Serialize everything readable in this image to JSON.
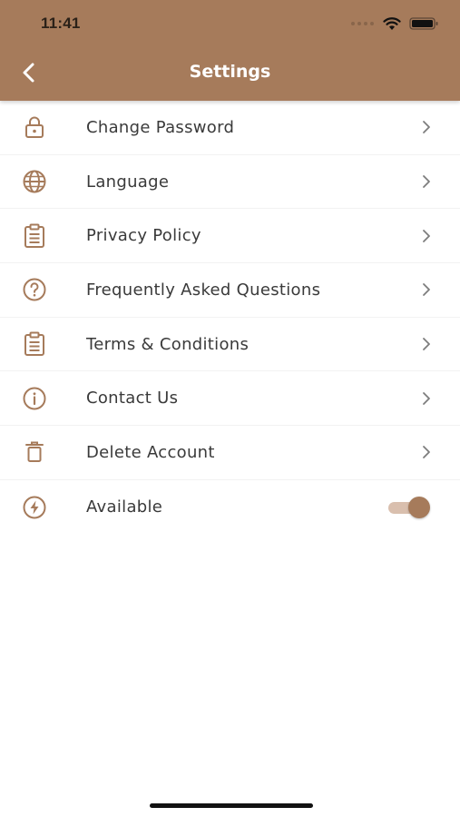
{
  "status_bar": {
    "time": "11:41"
  },
  "header": {
    "title": "Settings"
  },
  "colors": {
    "accent": "#a67b5b",
    "toggle_track": "#d9bfae",
    "text": "#3a3a3a"
  },
  "settings": {
    "items": [
      {
        "label": "Change Password",
        "icon": "lock-icon"
      },
      {
        "label": "Language",
        "icon": "globe-icon"
      },
      {
        "label": "Privacy Policy",
        "icon": "clipboard-icon"
      },
      {
        "label": "Frequently Asked Questions",
        "icon": "question-circle-icon"
      },
      {
        "label": "Terms & Conditions",
        "icon": "clipboard-icon"
      },
      {
        "label": "Contact Us",
        "icon": "info-circle-icon"
      },
      {
        "label": "Delete Account",
        "icon": "trash-icon"
      },
      {
        "label": "Available",
        "icon": "lightning-circle-icon",
        "toggle_on": true
      }
    ]
  }
}
